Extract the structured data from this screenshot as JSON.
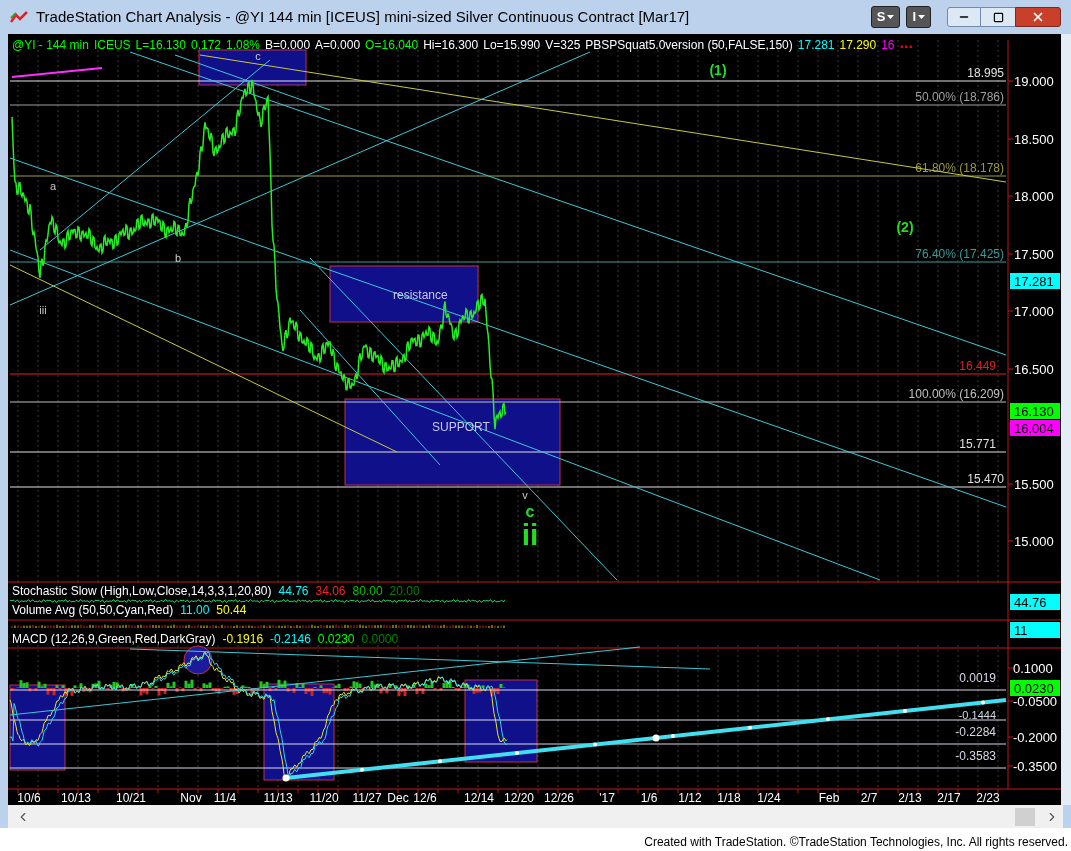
{
  "window": {
    "title": "TradeStation Chart Analysis - @YI 144 min [ICEUS] mini-sized Silver Continuous Contract [Mar17]",
    "menu_buttons": [
      {
        "label": "S"
      },
      {
        "label": "I"
      }
    ]
  },
  "header": [
    {
      "text": "@YI - 144 min",
      "color": "#00ff00"
    },
    {
      "text": "ICEUS",
      "color": "#00ff00"
    },
    {
      "text": "L=16.130",
      "color": "#00ff00"
    },
    {
      "text": "0.172",
      "color": "#00ff00"
    },
    {
      "text": "1.08%",
      "color": "#00ff00"
    },
    {
      "text": "B=0.000",
      "color": "#ffffff"
    },
    {
      "text": "A=0.000",
      "color": "#ffffff"
    },
    {
      "text": "O=16.040",
      "color": "#00ff00"
    },
    {
      "text": "Hi=16.300",
      "color": "#ffffff"
    },
    {
      "text": "Lo=15.990",
      "color": "#ffffff"
    },
    {
      "text": "V=325",
      "color": "#ffffff"
    },
    {
      "text": "PBSPSquat5.0version (50,FALSE,150)",
      "color": "#ffffff"
    },
    {
      "text": "17.281",
      "color": "#00ffff"
    },
    {
      "text": "17.290",
      "color": "#ffff00"
    },
    {
      "text": "16",
      "color": "#ff00ff"
    },
    {
      "text": "...",
      "color": "#ff0000"
    }
  ],
  "annotations": [
    {
      "text": "c",
      "kind": "letter"
    },
    {
      "text": "(1)",
      "kind": "degree"
    },
    {
      "text": "a",
      "kind": "letter"
    },
    {
      "text": "b",
      "kind": "letter"
    },
    {
      "text": "(2)",
      "kind": "degree"
    },
    {
      "text": "iii",
      "kind": "letter"
    },
    {
      "text": "v",
      "kind": "letter"
    },
    {
      "text": "c",
      "kind": "count"
    },
    {
      "text": "ii",
      "kind": "big"
    }
  ],
  "zones": [
    {
      "label": "resistance"
    },
    {
      "label": "SUPPORT"
    }
  ],
  "price_levels": [
    {
      "label": "18.995",
      "color": "#e0e0e0"
    },
    {
      "label": "50.00% (18.786)",
      "color": "#a0a0a0"
    },
    {
      "label": "61.80% (18.178)",
      "color": "#9a9a40"
    },
    {
      "label": "76.40% (17.425)",
      "color": "#3a9a9a"
    },
    {
      "label": "16.449",
      "color": "#e02020"
    },
    {
      "label": "100.00% (16.209)",
      "color": "#c0c0c0"
    },
    {
      "label": "15.771",
      "color": "#e0e0e0"
    },
    {
      "label": "15.470",
      "color": "#e0e0e0"
    }
  ],
  "price_axis": [
    "19.000",
    "18.500",
    "18.000",
    "17.500",
    "17.000",
    "16.500",
    "15.500",
    "15.000"
  ],
  "price_badges": [
    {
      "text": "17.281",
      "color": "#00ffff"
    },
    {
      "text": "16.130",
      "color": "#00ff00"
    },
    {
      "text": "16.004",
      "color": "#ff00ff"
    },
    {
      "text": "44.76",
      "color": "#00ffff"
    },
    {
      "text": "11",
      "color": "#00ffff"
    },
    {
      "text": "0.0230",
      "color": "#00ff00"
    }
  ],
  "indicators": [
    {
      "name": "Stochastic Slow (High,Low,Close,14,3,3,1,20,80)",
      "values": [
        {
          "text": "44.76",
          "color": "#00ffff"
        },
        {
          "text": "34.06",
          "color": "#ff2020"
        },
        {
          "text": "80.00",
          "color": "#00c000"
        },
        {
          "text": "20.00",
          "color": "#008000"
        }
      ]
    },
    {
      "name": "Volume Avg (50,50,Cyan,Red)",
      "values": [
        {
          "text": "11.00",
          "color": "#00ffff"
        },
        {
          "text": "50.44",
          "color": "#ffff00"
        }
      ]
    },
    {
      "name": "MACD (12,26,9,Green,Red,DarkGray)",
      "values": [
        {
          "text": "-0.1916",
          "color": "#ffff00"
        },
        {
          "text": "-0.2146",
          "color": "#00ffff"
        },
        {
          "text": "0.0230",
          "color": "#00ff00"
        },
        {
          "text": "0.0000",
          "color": "#008000"
        }
      ]
    }
  ],
  "macd_levels": [
    "0.0019",
    "-0.1444",
    "-0.2284",
    "-0.3583"
  ],
  "macd_axis": [
    "0.1000",
    "-0.0500",
    "-0.2000",
    "-0.3500"
  ],
  "date_axis": [
    "10/6",
    "10/13",
    "10/21",
    "Nov",
    "11/4",
    "11/13",
    "11/20",
    "11/27",
    "Dec",
    "12/6",
    "12/14",
    "12/20",
    "12/26",
    "'17",
    "1/6",
    "1/12",
    "1/18",
    "1/24",
    "Feb",
    "2/7",
    "2/13",
    "2/17",
    "2/23"
  ],
  "footer": "Created with TradeStation. ©TradeStation Technologies, Inc. All rights reserved."
}
